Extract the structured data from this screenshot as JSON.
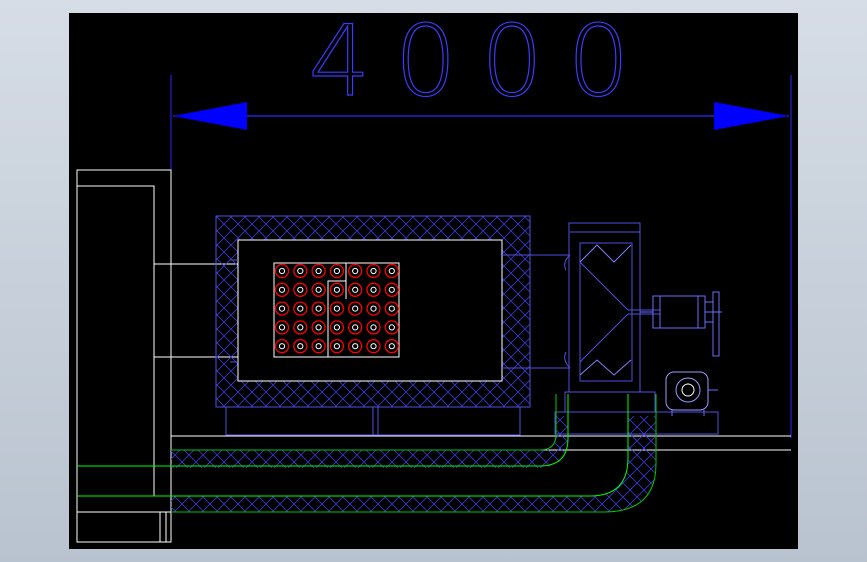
{
  "drawing": {
    "dimension_label": "4000",
    "colors": {
      "background": "#000000",
      "frame_outer": "#c7d0da",
      "dimension": "#0000ff",
      "hatch": "#3333cc",
      "outline": "#ffffff",
      "pipe": "#00ff00",
      "tube_ring": "#ff0000",
      "tube_core": "#ffffff"
    },
    "tube_bank": {
      "rows": 5,
      "cols": 7
    }
  }
}
